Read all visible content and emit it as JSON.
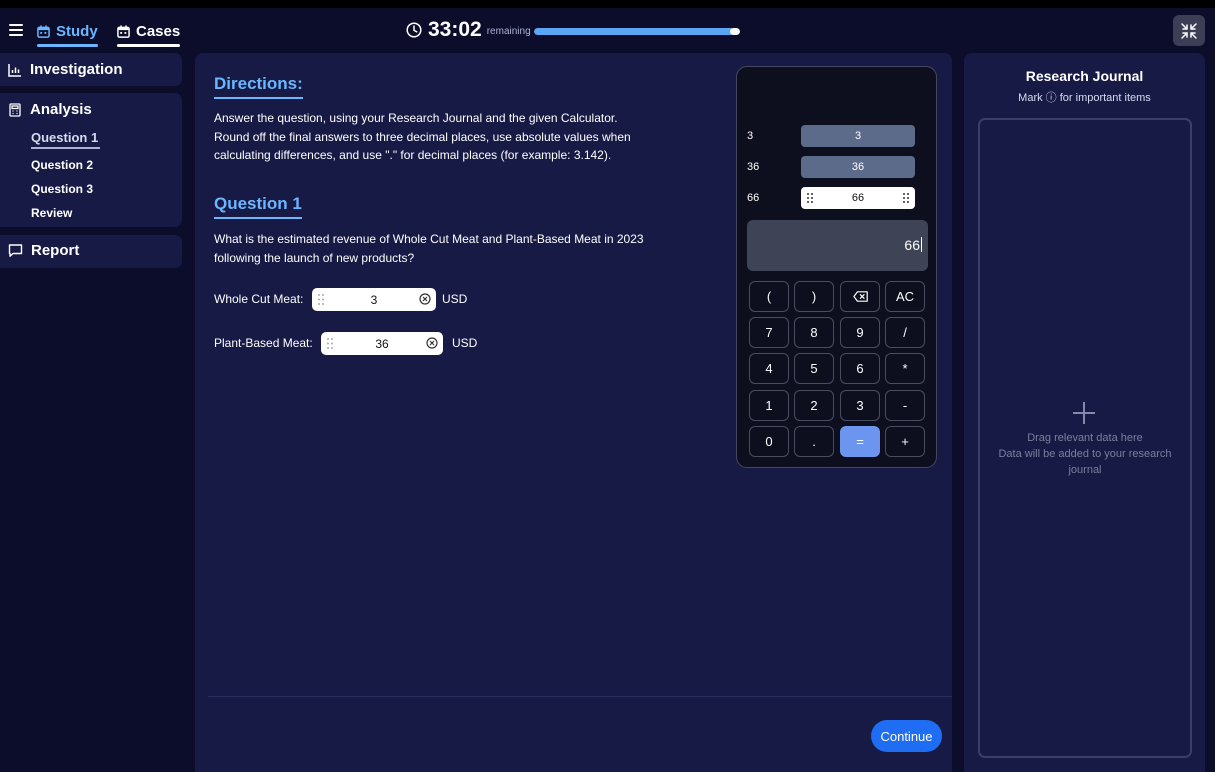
{
  "header": {
    "tabs": [
      {
        "label": "Study",
        "icon": "calendar-icon",
        "active": true
      },
      {
        "label": "Cases",
        "icon": "calendar-icon",
        "active": false
      }
    ],
    "timer": {
      "time": "33:02",
      "suffix": "remaining",
      "progress_fraction": 0.97
    }
  },
  "sidebar": {
    "investigation": "Investigation",
    "analysis": {
      "label": "Analysis",
      "items": [
        "Question 1",
        "Question 2",
        "Question 3",
        "Review"
      ],
      "active_index": 0
    },
    "report": "Report"
  },
  "main": {
    "directions_heading": "Directions:",
    "directions_lines": [
      "Answer the question, using your Research Journal and the given Calculator.",
      "Round off the final answers to three decimal places, use absolute values when",
      "calculating differences, and use \".\" for decimal places (for example: 3.142)."
    ],
    "question_heading": "Question 1",
    "question_lines": [
      "What is the estimated revenue of Whole Cut Meat and Plant-Based Meat in 2023",
      "following the launch of new products?"
    ],
    "fields": [
      {
        "label": "Whole Cut Meat:",
        "value": "3",
        "unit": "USD"
      },
      {
        "label": "Plant-Based Meat:",
        "value": "36",
        "unit": "USD"
      }
    ],
    "continue_label": "Continue"
  },
  "calculator": {
    "history": [
      {
        "label": "3",
        "value": "3"
      },
      {
        "label": "36",
        "value": "36"
      },
      {
        "label": "66",
        "value": "66"
      }
    ],
    "display": "66",
    "keys": [
      [
        "(",
        ")",
        "⌫",
        "AC"
      ],
      [
        "7",
        "8",
        "9",
        "/"
      ],
      [
        "4",
        "5",
        "6",
        "*"
      ],
      [
        "1",
        "2",
        "3",
        "-"
      ],
      [
        "0",
        ".",
        "=",
        "+"
      ]
    ]
  },
  "journal": {
    "title": "Research Journal",
    "subtitle": "Mark ⓘ for important items",
    "drop_line1": "Drag relevant data here",
    "drop_line2": "Data will be added to your research",
    "drop_line3": "journal"
  },
  "colors": {
    "accent": "#6cb6ff",
    "panel": "#171a45",
    "background": "#0c0d2b",
    "button": "#1f6df2",
    "equals_key": "#6c95ef"
  }
}
